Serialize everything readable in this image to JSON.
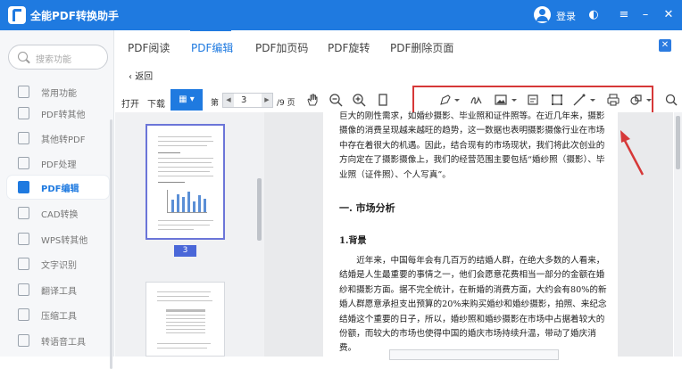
{
  "app": {
    "title": "全能PDF转换助手",
    "login": "登录"
  },
  "colors": {
    "brand": "#1f7ae0",
    "highlight": "#d63838",
    "page_badge": "#4a67d8"
  },
  "sidebar": {
    "search_placeholder": "搜索功能",
    "items": [
      {
        "label": "常用功能",
        "icon": "star-icon"
      },
      {
        "label": "PDF转其他",
        "icon": "pdf-export-icon"
      },
      {
        "label": "其他转PDF",
        "icon": "pdf-import-icon"
      },
      {
        "label": "PDF处理",
        "icon": "pdf-process-icon"
      },
      {
        "label": "PDF编辑",
        "icon": "pdf-edit-icon",
        "active": true
      },
      {
        "label": "CAD转换",
        "icon": "cad-icon"
      },
      {
        "label": "WPS转其他",
        "icon": "wps-icon"
      },
      {
        "label": "文字识别",
        "icon": "ocr-icon"
      },
      {
        "label": "翻译工具",
        "icon": "translate-icon"
      },
      {
        "label": "压缩工具",
        "icon": "compress-icon"
      },
      {
        "label": "转语音工具",
        "icon": "speech-icon"
      }
    ]
  },
  "tabs": [
    "PDF阅读",
    "PDF编辑",
    "PDF加页码",
    "PDF旋转",
    "PDF删除页面"
  ],
  "back": "返回",
  "toolbar": {
    "open": "打开",
    "download": "下载",
    "page_prefix": "第",
    "page": "3",
    "total": "/9 页"
  },
  "thumbnails": {
    "selected_page": "3"
  },
  "document": {
    "para1": "巨大的刚性需求，如婚纱摄影、毕业照和证件照等。在近几年来，摄影摄像的消费呈现越来越旺的趋势，这一数据也表明摄影摄像行业在市场中存在着很大的机遇。因此，结合现有的市场现状，我们将此次创业的方向定在了摄影摄像上，我们的经营范围主要包括“婚纱照（摄影）、毕业照（证件照）、个人写真”。",
    "heading1": "一. 市场分析",
    "heading2": "1.背景",
    "para2": "近年来，中国每年会有几百万的结婚人群，在绝大多数的人看来，结婚是人生最重要的事情之一，他们会愿意花费相当一部分的金额在婚纱和摄影方面。据不完全统计，在新婚的消费方面，大约会有80%的新婚人群愿意承担支出预算的20%来购买婚纱和婚纱摄影，拍照、来纪念结婚这个重要的日子，所以，婚纱照和婚纱摄影在市场中占据着较大的份额，而较大的市场也使得中国的婚庆市场持续升温，带动了婚庆消费。"
  }
}
